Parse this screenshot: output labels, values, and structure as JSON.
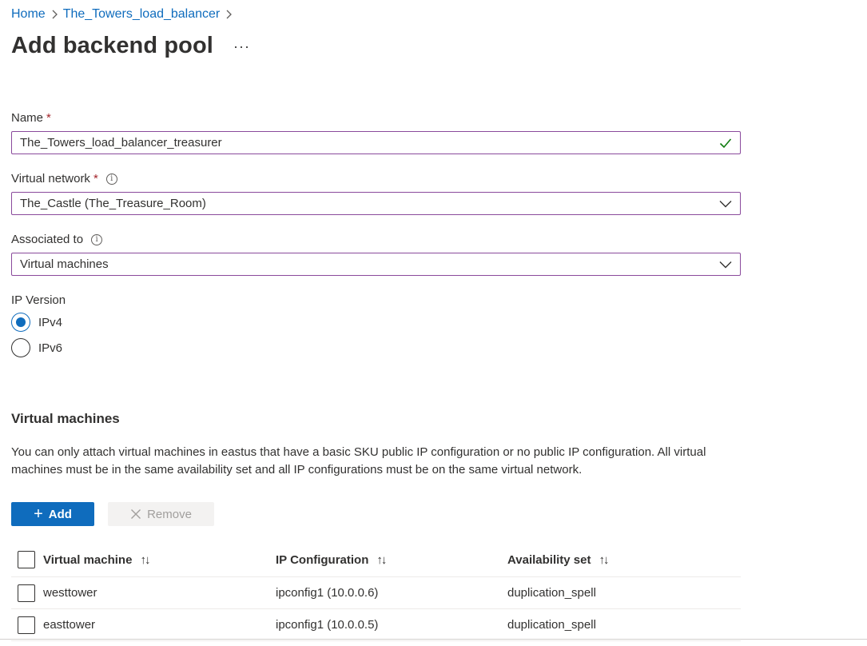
{
  "breadcrumb": {
    "items": [
      "Home",
      "The_Towers_load_balancer"
    ]
  },
  "page": {
    "title": "Add backend pool",
    "more_label": "···"
  },
  "form": {
    "name": {
      "label": "Name",
      "required_mark": "*",
      "value": "The_Towers_load_balancer_treasurer"
    },
    "virtual_network": {
      "label": "Virtual network",
      "required_mark": "*",
      "info_glyph": "i",
      "value": "The_Castle (The_Treasure_Room)"
    },
    "associated_to": {
      "label": "Associated to",
      "info_glyph": "i",
      "value": "Virtual machines"
    },
    "ip_version": {
      "label": "IP Version",
      "options": [
        {
          "label": "IPv4",
          "selected": true
        },
        {
          "label": "IPv6",
          "selected": false
        }
      ]
    }
  },
  "vm_section": {
    "title": "Virtual machines",
    "description": "You can only attach virtual machines in eastus that have a basic SKU public IP configuration or no public IP configuration. All virtual machines must be in the same availability set and all IP configurations must be on the same virtual network.",
    "add_label": "Add",
    "add_glyph": "+",
    "remove_label": "Remove"
  },
  "table": {
    "columns": [
      "Virtual machine",
      "IP Configuration",
      "Availability set"
    ],
    "sort_glyph": "↑↓",
    "rows": [
      {
        "vm": "westtower",
        "ip": "ipconfig1 (10.0.0.6)",
        "avset": "duplication_spell"
      },
      {
        "vm": "easttower",
        "ip": "ipconfig1 (10.0.0.5)",
        "avset": "duplication_spell"
      }
    ]
  },
  "icons": {
    "breadcrumb_separator": "chevron-right-icon",
    "valid": "checkmark-icon",
    "dropdown": "chevron-down-icon",
    "info": "info-icon",
    "add": "plus-icon",
    "remove": "close-icon",
    "sort": "sort-icon"
  },
  "colors": {
    "link": "#0f6cbd",
    "primary_button": "#0f6cbd",
    "input_border": "#8a4a9c",
    "required": "#a4262c",
    "valid_check": "#107c10",
    "disabled_bg": "#f3f2f1",
    "disabled_text": "#a19f9d"
  }
}
